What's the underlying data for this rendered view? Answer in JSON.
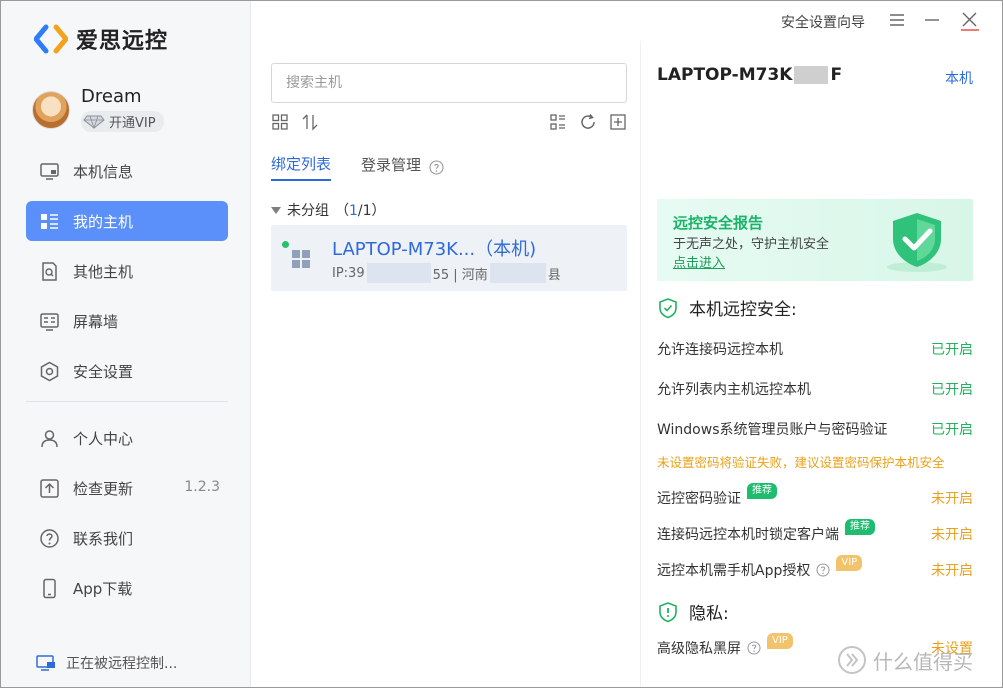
{
  "app": {
    "name": "爱思远控"
  },
  "user": {
    "name": "Dream",
    "vip_label": "开通VIP"
  },
  "nav": {
    "items": [
      {
        "label": "本机信息"
      },
      {
        "label": "我的主机"
      },
      {
        "label": "其他主机"
      },
      {
        "label": "屏幕墙"
      },
      {
        "label": "安全设置"
      },
      {
        "label": "个人中心"
      },
      {
        "label": "检查更新",
        "version": "1.2.3"
      },
      {
        "label": "联系我们"
      },
      {
        "label": "App下载"
      }
    ]
  },
  "status_text": "正在被远程控制...",
  "titlebar": {
    "wizard_label": "安全设置向导"
  },
  "middle": {
    "search_placeholder": "搜索主机",
    "tabs": [
      {
        "label": "绑定列表"
      },
      {
        "label": "登录管理"
      }
    ],
    "group": {
      "name": "未分组",
      "open": "（",
      "current": "1",
      "total": "/1",
      "close": "）"
    },
    "host": {
      "name": "LAPTOP-M73K...（本机)",
      "ip_prefix": "IP:39",
      "ip_suffix": "55 | 河南",
      "region_suffix": "县"
    }
  },
  "right": {
    "pc_name_prefix": "LAPTOP-M73K",
    "pc_name_suffix": "F",
    "this_pc": "本机",
    "banner": {
      "title": "远控安全报告",
      "subtitle": "于无声之处，守护主机安全",
      "link": "点击进入"
    },
    "security_title": "本机远控安全:",
    "settings": [
      {
        "label": "允许连接码远控本机",
        "value": "已开启"
      },
      {
        "label": "允许列表内主机远控本机",
        "value": "已开启"
      },
      {
        "label": "Windows系统管理员账户与密码验证",
        "value": "已开启"
      },
      {
        "label": "远控密码验证",
        "tag": "推荐",
        "value": "未开启"
      },
      {
        "label": "连接码远控本机时锁定客户端",
        "tag": "推荐",
        "value": "未开启"
      },
      {
        "label": "远控本机需手机App授权",
        "tag": "VIP",
        "value": "未开启"
      }
    ],
    "warning": "未设置密码将验证失败，建议设置密码保护本机安全",
    "privacy_title": "隐私:",
    "privacy": {
      "label": "高级隐私黑屏",
      "tag": "VIP",
      "value": "未设置"
    }
  },
  "watermark": "什么值得买",
  "colors": {
    "accent": "#5b8ff9",
    "link": "#2f6bd8",
    "on": "#23b15f",
    "off": "#e9a11b"
  }
}
